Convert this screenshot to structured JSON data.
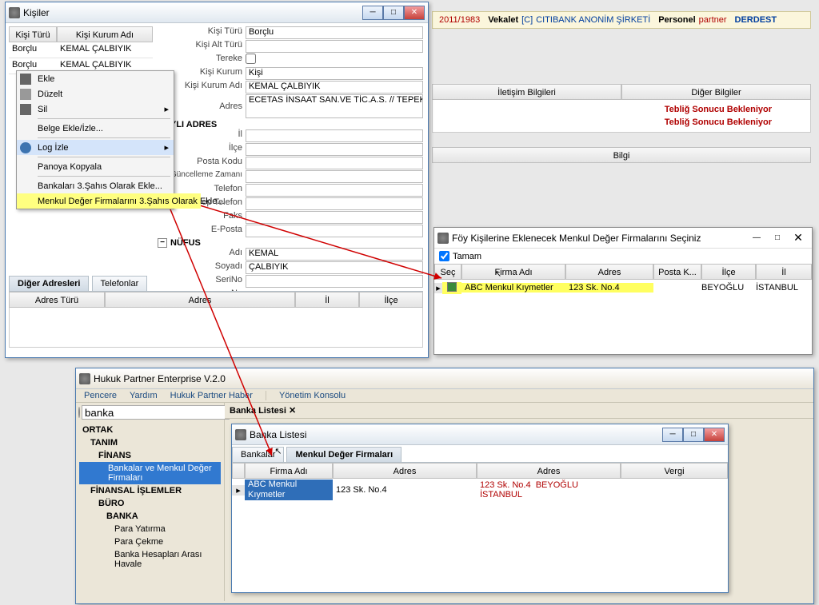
{
  "topRow": {
    "year": "2011/1983",
    "vekalet": "Vekalet",
    "vekaletCode": "[C]",
    "vekaletFirm": "CITIBANK ANONİM ŞİRKETİ",
    "personel": "Personel",
    "personelName": "partner",
    "status": "DERDEST"
  },
  "rightPanel": {
    "iletisim": "İletişim Bilgileri",
    "diger": "Diğer Bilgiler",
    "teblig": "Tebliğ Sonucu Bekleniyor",
    "bilgi": "Bilgi"
  },
  "kisiWin": {
    "title": "Kişiler",
    "colKisiTuru": "Kişi Türü",
    "colKisiKurum": "Kişi Kurum Adı",
    "rows": [
      {
        "tur": "Borçlu",
        "ad": "KEMAL ÇALBIYIK"
      },
      {
        "tur": "Borçlu",
        "ad": "KEMAL ÇALBIYIK"
      }
    ],
    "form": {
      "kisiTuru_l": "Kişi Türü",
      "kisiTuru_v": "Borçlu",
      "kisiAltTuru_l": "Kişi Alt Türü",
      "kisiAltTuru_v": "",
      "tereke_l": "Tereke",
      "tereke_v": "",
      "kisiKurum_l": "Kişi Kurum",
      "kisiKurum_v": "Kişi",
      "kisiKurumAdi_l": "Kişi Kurum Adı",
      "kisiKurumAdi_v": "KEMAL ÇALBIYIK",
      "adres_l": "Adres",
      "adres_v": "ECETAS İNSAAT SAN.VE TİC.A.S. // TEPEKUM MH.",
      "yliHead": "YLI ADRES",
      "il_l": "İl",
      "ilce_l": "İlçe",
      "posta_l": "Posta Kodu",
      "gunc_l": "Güncelleme Zamanı",
      "tel_l": "Telefon",
      "cep_l": "Cep Telefon",
      "faks_l": "Faks",
      "eposta_l": "E-Posta",
      "nufusHead": "NÜFUS",
      "adi_l": "Adı",
      "adi_v": "KEMAL",
      "soyadi_l": "Soyadı",
      "soyadi_v": "ÇALBIYIK",
      "seri_l": "SeriNo",
      "seri_v": "",
      "no_l": "No"
    },
    "tabs": {
      "diger": "Diğer Adresleri",
      "tel": "Telefonlar"
    },
    "gridH": {
      "adresTuru": "Adres Türü",
      "adres": "Adres",
      "il": "İl",
      "ilce": "İlçe"
    }
  },
  "ctx": {
    "ekle": "Ekle",
    "duzelt": "Düzelt",
    "sil": "Sil",
    "belge": "Belge Ekle/İzle...",
    "log": "Log İzle",
    "pano": "Panoya Kopyala",
    "bank": "Bankaları 3.Şahıs Olarak Ekle...",
    "menkul": "Menkul Değer Firmalarını 3.Şahıs Olarak Ekle..."
  },
  "menkulPopup": {
    "title": "Föy Kişilerine Eklenecek Menkul Değer Firmalarını Seçiniz",
    "tamam": "Tamam",
    "cols": {
      "sec": "Seç",
      "firma": "Firma Adı",
      "adres": "Adres",
      "posta": "Posta K...",
      "ilce": "İlçe",
      "il": "İl"
    },
    "row": {
      "firma": "ABC Menkul Kıymetler",
      "adres": "123 Sk. No.4",
      "posta": "",
      "ilce": "BEYOĞLU",
      "il": "İSTANBUL"
    }
  },
  "mainApp": {
    "title": "Hukuk Partner Enterprise V.2.0",
    "menu": {
      "pencere": "Pencere",
      "yardim": "Yardım",
      "haber": "Hukuk Partner Haber",
      "yonetim": "Yönetim Konsolu"
    },
    "search": "banka",
    "tree": {
      "ortak": "ORTAK",
      "tanim": "TANIM",
      "finans": "FİNANS",
      "bankalar": "Bankalar ve Menkul Değer Firmaları",
      "finIslem": "FİNANSAL İŞLEMLER",
      "buro": "BÜRO",
      "banka": "BANKA",
      "paraYatir": "Para Yatırma",
      "paraCek": "Para Çekme",
      "havale": "Banka Hesapları Arası Havale"
    },
    "listTab": "Banka Listesi"
  },
  "bankaList": {
    "title": "Banka Listesi",
    "tabs": {
      "bankalar": "Bankalar",
      "menkul": "Menkul Değer Firmaları"
    },
    "cols": {
      "firma": "Firma Adı",
      "adres": "Adres",
      "adres2": "Adres",
      "vergi": "Vergi"
    },
    "row": {
      "firma": "ABC Menkul Kıymetler",
      "adres": "123 Sk. No.4",
      "adres2": "123 Sk. No.4",
      "loc": "BEYOĞLU İSTANBUL"
    }
  }
}
